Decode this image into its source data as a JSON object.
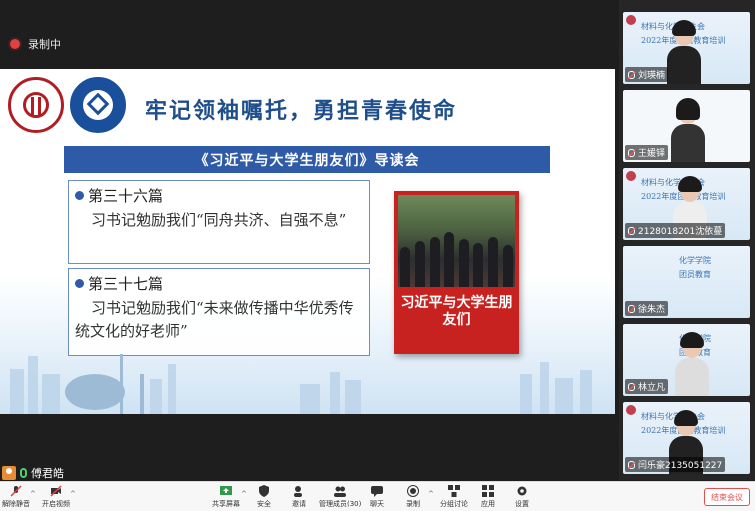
{
  "recording": {
    "label": "录制中"
  },
  "slide": {
    "headline": "牢记领袖嘱托，勇担青春使命",
    "banner": "《习近平与大学生朋友们》导读会",
    "sections": [
      {
        "title": "第三十六篇",
        "body": "习书记勉励我们“同舟共济、自强不息”"
      },
      {
        "title": "第三十七篇",
        "body": "习书记勉励我们“未来做传播中华优秀传统文化的好老师”"
      }
    ],
    "book": {
      "title": "习近平与大学生朋友们"
    }
  },
  "gallery": [
    {
      "name": "刘瑛楠"
    },
    {
      "name": "王媛铎"
    },
    {
      "name": "2128018201沈依蔓"
    },
    {
      "name": "徐朱杰"
    },
    {
      "name": "林立凡"
    },
    {
      "name": "闫乐豪2135051227"
    }
  ],
  "speaker": {
    "name": "傅君皓"
  },
  "toolbar": {
    "unmute": "解除静音",
    "start_video": "开启视频",
    "share": "共享屏幕",
    "security": "安全",
    "invite": "邀请",
    "participants": "管理成员(30)",
    "chat": "聊天",
    "record": "录制",
    "breakout": "分组讨论",
    "apps": "应用",
    "settings": "设置",
    "end": "结束会议"
  },
  "colors": {
    "accent": "#2e5aa8",
    "record": "#e04040",
    "end": "#e05050"
  }
}
